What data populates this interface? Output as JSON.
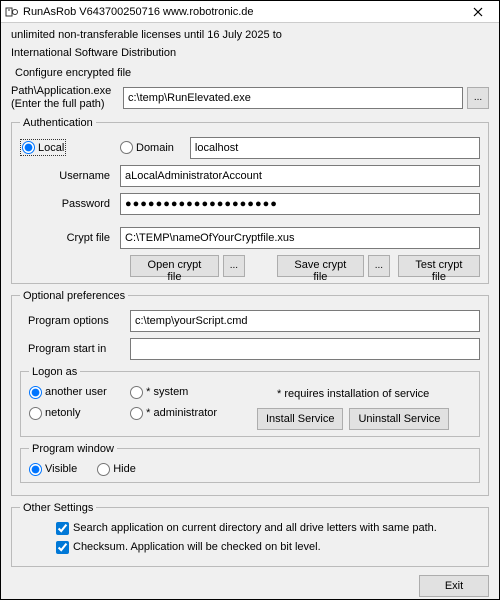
{
  "window": {
    "title": "RunAsRob V643700250716 www.robotronic.de",
    "close": "✕"
  },
  "license": {
    "line1": "unlimited non-transferable licenses until 16 July 2025 to",
    "line2": "International Software Distribution"
  },
  "configure": "Configure encrypted file",
  "path": {
    "label": "Path\\Application.exe\n(Enter the full path)",
    "label1": "Path\\Application.exe",
    "label2": "(Enter the full path)",
    "value": "c:\\temp\\RunElevated.exe",
    "browse": "..."
  },
  "auth": {
    "legend": "Authentication",
    "local": "Local",
    "domain": "Domain",
    "host": "localhost",
    "username_label": "Username",
    "username": "aLocalAdministratorAccount",
    "password_label": "Password",
    "password": "●●●●●●●●●●●●●●●●●●●●",
    "cryptfile_label": "Crypt file",
    "cryptfile": "C:\\TEMP\\nameOfYourCryptfile.xus",
    "open": "Open crypt file",
    "dots": "...",
    "save": "Save crypt file",
    "test": "Test crypt file"
  },
  "opt": {
    "legend": "Optional preferences",
    "options_label": "Program options",
    "options": "c:\\temp\\yourScript.cmd",
    "startin_label": "Program start in",
    "startin": ""
  },
  "logon": {
    "legend": "Logon as",
    "another": "another user",
    "system": "* system",
    "netonly": "netonly",
    "admin": "* administrator",
    "requires": "* requires installation of service",
    "install": "Install Service",
    "uninstall": "Uninstall Service"
  },
  "pw": {
    "legend": "Program window",
    "visible": "Visible",
    "hide": "Hide"
  },
  "other": {
    "legend": "Other Settings",
    "search": "Search application on current directory and all drive letters with same path.",
    "checksum": "Checksum. Application will be checked on bit level."
  },
  "footer": {
    "exit": "Exit"
  }
}
